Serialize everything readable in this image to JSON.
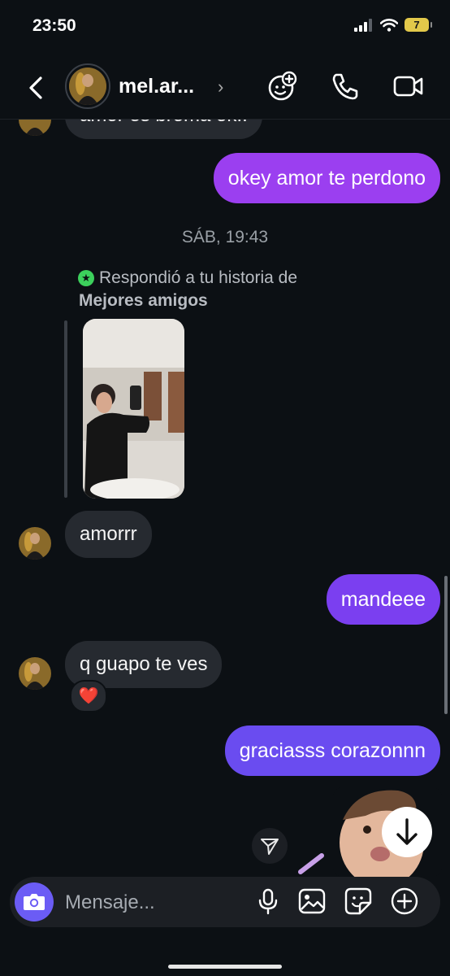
{
  "status": {
    "time": "23:50",
    "battery": "7"
  },
  "header": {
    "contact_name": "mel.ar..."
  },
  "messages": {
    "partial_top": "amor es broma ok..",
    "out1": "okey amor te perdono",
    "timestamp": "SÁB, 19:43",
    "story_reply_line1": "Respondió a tu historia de",
    "story_reply_line2": "Mejores amigos",
    "in1": "amorrr",
    "out2": "mandeee",
    "in2": "q guapo te ves",
    "reaction": "❤️",
    "out3": "graciasss corazonnn"
  },
  "composer": {
    "placeholder": "Mensaje..."
  },
  "colors": {
    "background": "#0c1014",
    "incoming_bubble": "#262a30",
    "outgoing_purple_1": "#9b3ff0",
    "outgoing_purple_2": "#7b3ff0",
    "outgoing_purple_3": "#6a4cf0",
    "camera_button": "#6b5cf5",
    "close_friends_green": "#3cd05c"
  },
  "icons": {
    "back": "chevron-left-icon",
    "effects": "face-sparkle-icon",
    "call": "phone-icon",
    "video": "video-camera-icon",
    "camera": "camera-icon",
    "mic": "microphone-icon",
    "gallery": "image-icon",
    "sticker": "sticker-icon",
    "more": "plus-circle-icon",
    "scroll_down": "arrow-down-icon",
    "send": "paper-plane-icon"
  }
}
